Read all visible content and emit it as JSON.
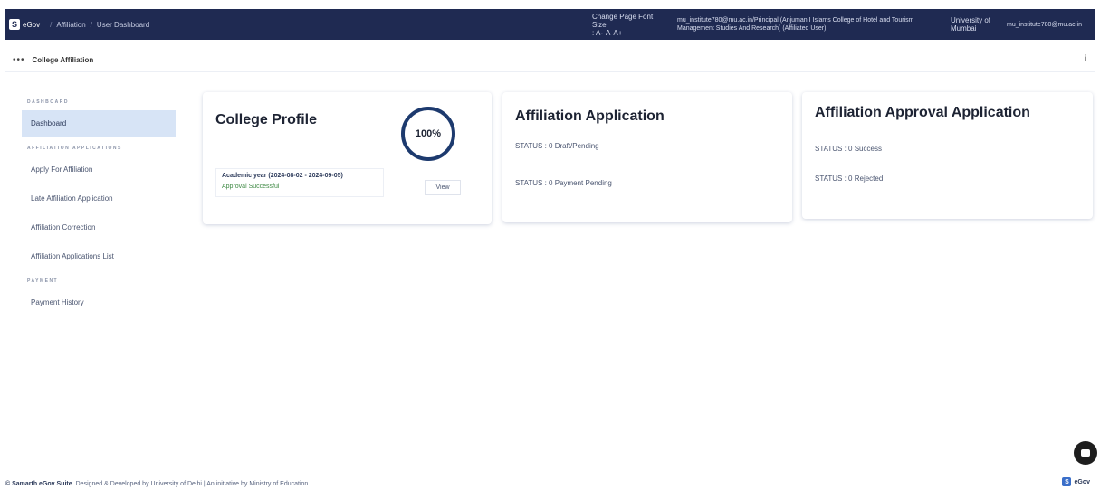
{
  "header": {
    "brand_badge": "S",
    "brand_name": "eGov",
    "breadcrumbs": [
      "Affiliation",
      "User Dashboard"
    ],
    "font_size_label": "Change Page Font Size",
    "font_buttons": [
      ": A-",
      "A",
      "A+"
    ],
    "user_info": "mu_institute780@mu.ac.in/Principal (Anjuman I Islams College of Hotel and Tourism Management Studies And Research) (Affiliated User)",
    "university": "University of Mumbai",
    "email": "mu_institute780@mu.ac.in"
  },
  "subheader": {
    "title": "College Affiliation",
    "info_icon": "i"
  },
  "sidebar": {
    "sections": [
      {
        "title": "DASHBOARD",
        "items": [
          "Dashboard"
        ]
      },
      {
        "title": "AFFILIATION APPLICATIONS",
        "items": [
          "Apply For Affiliation",
          "Late Affiliation Application",
          "Affiliation Correction",
          "Affiliation Applications List"
        ]
      },
      {
        "title": "PAYMENT",
        "items": [
          "Payment History"
        ]
      }
    ],
    "active_item": "Dashboard"
  },
  "college_profile": {
    "title": "College Profile",
    "progress_text": "100%",
    "progress_value": 100,
    "academic_year": "Academic year (2024-08-02 - 2024-09-05)",
    "approval_status": "Approval Successful",
    "view_label": "View"
  },
  "affiliation_application": {
    "title": "Affiliation Application",
    "statuses": [
      "STATUS : 0 Draft/Pending",
      "STATUS : 0 Payment Pending"
    ]
  },
  "approval_application": {
    "title": "Affiliation Approval Application",
    "statuses": [
      "STATUS : 0 Success",
      "STATUS : 0 Rejected"
    ]
  },
  "footer": {
    "suite": "© Samarth eGov Suite",
    "credits": "Designed & Developed by University of Delhi | An initiative by Ministry of Education",
    "logo_badge": "S",
    "logo_text": "eGov"
  },
  "colors": {
    "topbar": "#1f2a52",
    "active_nav": "#d7e4f6",
    "ring": "#1d3a6e",
    "approval_green": "#3f8a45"
  }
}
